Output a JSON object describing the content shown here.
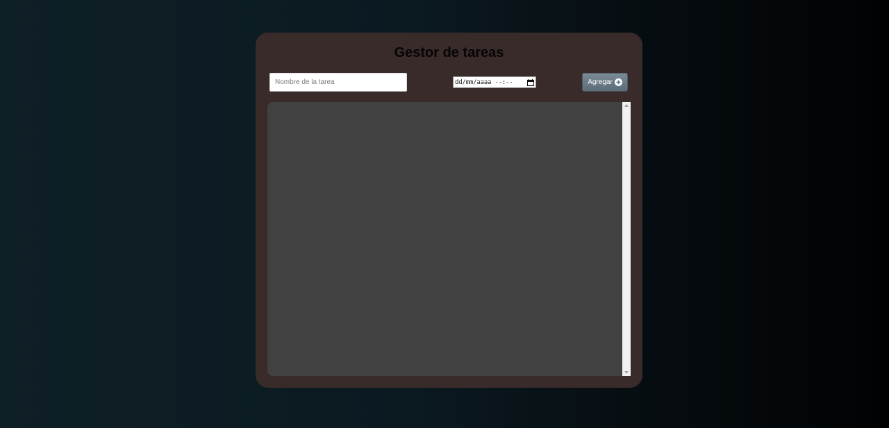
{
  "app": {
    "title": "Gestor de tareas"
  },
  "form": {
    "task_name": {
      "placeholder": "Nombre de la tarea",
      "value": ""
    },
    "datetime": {
      "display": "dd/mm/aaaa --:--"
    },
    "add_button": {
      "label": "Agregar",
      "icon": "plus-circle-icon"
    }
  },
  "task_list": {
    "items": []
  },
  "colors": {
    "card_background": "#392b2a",
    "list_background": "#414141",
    "button_background": "#6b7b87",
    "page_background_start": "#0f1f26",
    "page_background_end": "#010203"
  }
}
